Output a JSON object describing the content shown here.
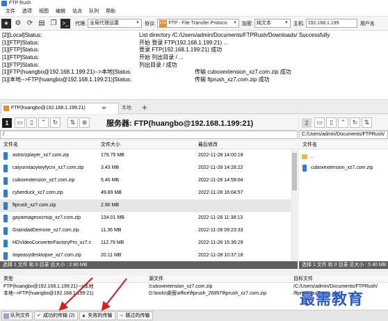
{
  "window": {
    "title": "FTP Rush"
  },
  "menu": {
    "items": [
      "文件",
      "选项",
      "视图",
      "编辑",
      "站点",
      "队列",
      "帮助"
    ]
  },
  "toolbar": {
    "proxy_label": "代理:",
    "proxy_value": "全局代理设置",
    "protocol_label": "协议:",
    "protocol_chip": "FTP",
    "protocol_value": "FTP - File Transfer Protoco",
    "encrypt_label": "加密:",
    "encrypt_value": "纯文本",
    "host_label": "主机:",
    "host_value": "192.168.1.199",
    "user_label": "用户名"
  },
  "log": [
    {
      "src": "[2][Local]Status:",
      "msg": "List directory /C:/Users/admin/Documents/FTPRush/Downloads/ Successfully",
      "wide": false
    },
    {
      "src": "[1][FTP]Status:",
      "msg": "开始 登录 FTP(192.168.1.199:21) ...",
      "wide": false
    },
    {
      "src": "[1][FTP]Status:",
      "msg": "登录 FTP(192.168.1.199:21) 成功",
      "wide": false
    },
    {
      "src": "[1][FTP]Status:",
      "msg": "开始 列出目录 / ...",
      "wide": false
    },
    {
      "src": "[1][FTP]Status:",
      "msg": "列出目录 / 成功",
      "wide": false
    },
    {
      "src": "[1][FTP(huangbo@192.168.1.199:21)-->本地]Status:",
      "msg": "传输 cuboxextension_xz7.com.zip 成功",
      "wide": true
    },
    {
      "src": "[1][本地-->FTP(huangbo@192.168.1.199:21)]Status:",
      "msg": "传输 ftprush_xz7.com.zip 成功",
      "wide": true
    }
  ],
  "tabs": {
    "active_label": "FTP(huangbo@192.168.1.199:21)",
    "local_label": "本地",
    "add_label": "+"
  },
  "left_pane": {
    "number": "1",
    "server_label": "服务器:  FTP(huangbo@192.168.1.199:21)",
    "path": "/",
    "headers": {
      "name": "文件名",
      "size": "文件大小",
      "modified": "最后修改"
    },
    "files": [
      {
        "name": "astrorzplayer_xz7.com.zip",
        "size": "179.75 MB",
        "date": "2022-11-28 14:00:18",
        "selected": false
      },
      {
        "name": "caiyunxiaoyiwyfycrx_xz7.com.zip",
        "size": "3.43 MB",
        "date": "2022-11-28 14:28:22",
        "selected": false
      },
      {
        "name": "cuboxextension_xz7.com.zip",
        "size": "5.40 MB",
        "date": "2022-11-28 14:59:04",
        "selected": false
      },
      {
        "name": "cyberduck_xz7.com.zip",
        "size": "49.89 MB",
        "date": "2022-11-28 16:04:57",
        "selected": false
      },
      {
        "name": "ftprush_xz7.com.zip",
        "size": "2.90 MB",
        "date": "",
        "selected": true
      },
      {
        "name": "gayaimagesocrtup_xz7.com.zip",
        "size": "134.01 MB",
        "date": "2022-11-28 11:38:13",
        "selected": false
      },
      {
        "name": "GraindadDemoxe_xz7.com.zip",
        "size": "11.36 MB",
        "date": "2022-11-28 09:23:33",
        "selected": false
      },
      {
        "name": "HDVideoConverterFactoryPro_xz7.c",
        "size": "112.79 MB",
        "date": "2022-11-28 15:36:29",
        "selected": false
      },
      {
        "name": "itopeasydesktopxe_xz7.com.zip",
        "size": "20.11 MB",
        "date": "2022-11-28 10:37:18",
        "selected": false
      }
    ],
    "status": "选择 1 文件 和 0 目录 总大小 : 2.90 MB"
  },
  "right_pane": {
    "number": "2",
    "path": "C:/Users/admin/Documents/FTPRush/",
    "header_name": "文件名",
    "files": [
      {
        "name": "..",
        "type": "folder"
      },
      {
        "name": "cuboxextension_xz7.com.zip",
        "type": "file"
      }
    ],
    "status": "选择 1 文件 和 0 目录 总大小 : 5.40 MB"
  },
  "queue": {
    "headers": {
      "type": "类型",
      "remote": "源文件",
      "local": "目标文件"
    },
    "rows": [
      {
        "type": "FTP(huangbo@192.168.1.199:21)-->本地",
        "remote": "/cuboxextension_xz7.com.zip",
        "local": "/C:/Users/admin/Documents/FTPRush/"
      },
      {
        "type": "本地-->FTP(huangbo@192.168.1.199:21)",
        "remote": "D:\\tools\\桌面\\office\\ftprush_26997\\ftprush_xz7.com.zip",
        "local": "/ftprush_xz7.com.zip"
      }
    ]
  },
  "bottom_tabs": [
    {
      "label": "队列文件",
      "icon": "queue-icon"
    },
    {
      "label": "成功的传输 (2)",
      "icon": "check-icon"
    },
    {
      "label": "失败的传输",
      "icon": "warning-icon"
    },
    {
      "label": "跳过的传输",
      "icon": "skip-icon"
    }
  ],
  "watermark": {
    "text": "最需教育"
  },
  "colors": {
    "accent_orange": "#f08a24",
    "file_icon_blue": "#2d7dd2",
    "status_bar": "#5f5f5f",
    "arrow_red": "#d81e1e",
    "watermark_blue": "#2a57c9"
  }
}
